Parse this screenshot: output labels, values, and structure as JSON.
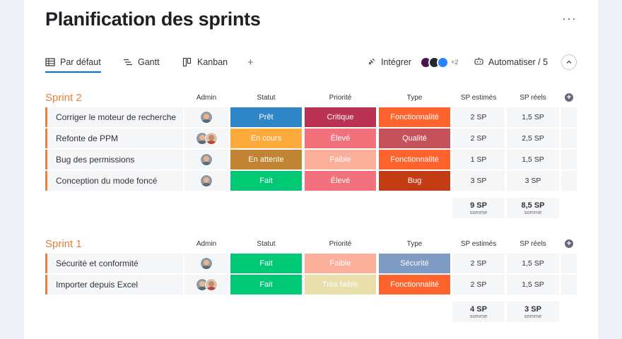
{
  "page": {
    "title": "Planification des sprints",
    "menu": "···"
  },
  "toolbar": {
    "tabs": [
      {
        "label": "Par défaut",
        "icon": "table-icon"
      },
      {
        "label": "Gantt",
        "icon": "gantt-icon"
      },
      {
        "label": "Kanban",
        "icon": "kanban-icon"
      }
    ],
    "add": "+",
    "integrate_label": "Intégrer",
    "integrations_more": "+2",
    "automate_label": "Automatiser / 5"
  },
  "columns": {
    "admin": "Admin",
    "status": "Statut",
    "priority": "Priorité",
    "type": "Type",
    "sp_est": "SP estimés",
    "sp_real": "SP réels"
  },
  "colors": {
    "group_accent": "#e8813c",
    "pret": "#2e86c9",
    "en_cours": "#fdab3d",
    "en_attente": "#c08433",
    "fait": "#00c875",
    "critique": "#bb3354",
    "eleve": "#e2445c",
    "eleve_light": "#f37d7e",
    "faible": "#fbaf9b",
    "tres_faible": "#e9dfaa",
    "fonctionnalite": "#ff642e",
    "qualite": "#c5525a",
    "bug": "#c43c14",
    "securite": "#7f9bc4"
  },
  "groups": [
    {
      "title": "Sprint 2",
      "rows": [
        {
          "name": "Corriger le moteur de recherche",
          "admins": 1,
          "status": "Prêt",
          "status_color": "#2e86c9",
          "priority": "Critique",
          "priority_color": "#bb3354",
          "type": "Fonctionnalité",
          "type_color": "#ff642e",
          "sp_est": "2 SP",
          "sp_real": "1,5 SP"
        },
        {
          "name": "Refonte de PPM",
          "admins": 2,
          "status": "En cours",
          "status_color": "#fdab3d",
          "priority": "Élevé",
          "priority_color": "#f2727b",
          "type": "Qualité",
          "type_color": "#c5525a",
          "sp_est": "2 SP",
          "sp_real": "2,5 SP"
        },
        {
          "name": "Bug des permissions",
          "admins": 1,
          "status": "En attente",
          "status_color": "#c08433",
          "priority": "Faible",
          "priority_color": "#fbaf9b",
          "type": "Fonctionnalité",
          "type_color": "#ff642e",
          "sp_est": "1 SP",
          "sp_real": "1,5 SP"
        },
        {
          "name": "Conception du mode foncé",
          "admins": 1,
          "status": "Fait",
          "status_color": "#00c875",
          "priority": "Élevé",
          "priority_color": "#f2727b",
          "type": "Bug",
          "type_color": "#c43c14",
          "sp_est": "3 SP",
          "sp_real": "3 SP"
        }
      ],
      "sum_est": "9 SP",
      "sum_real": "8,5 SP",
      "sum_label": "somme"
    },
    {
      "title": "Sprint 1",
      "rows": [
        {
          "name": "Sécurité et conformité",
          "admins": 1,
          "status": "Fait",
          "status_color": "#00c875",
          "priority": "Faible",
          "priority_color": "#fbaf9b",
          "type": "Sécurité",
          "type_color": "#7f9bc4",
          "sp_est": "2 SP",
          "sp_real": "1,5 SP"
        },
        {
          "name": "Importer depuis Excel",
          "admins": 2,
          "status": "Fait",
          "status_color": "#00c875",
          "priority": "Très faible",
          "priority_color": "#e9dfaa",
          "type": "Fonctionnalité",
          "type_color": "#ff642e",
          "sp_est": "2 SP",
          "sp_real": "1,5 SP"
        }
      ],
      "sum_est": "4 SP",
      "sum_real": "3 SP",
      "sum_label": "somme"
    }
  ]
}
